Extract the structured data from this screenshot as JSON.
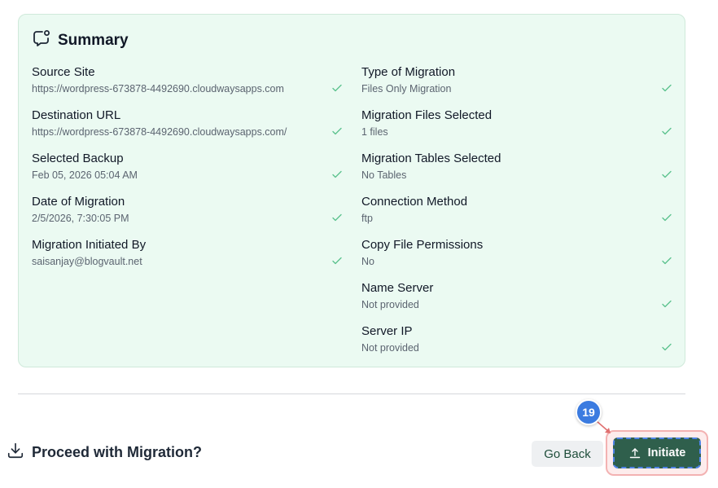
{
  "summary": {
    "title": "Summary",
    "left_fields": [
      {
        "label": "Source Site",
        "value": "https://wordpress-673878-4492690.cloudwaysapps.com"
      },
      {
        "label": "Destination URL",
        "value": "https://wordpress-673878-4492690.cloudwaysapps.com/"
      },
      {
        "label": "Selected Backup",
        "value": "Feb 05, 2026 05:04 AM"
      },
      {
        "label": "Date of Migration",
        "value": "2/5/2026, 7:30:05 PM"
      },
      {
        "label": "Migration Initiated By",
        "value": "saisanjay@blogvault.net"
      }
    ],
    "right_fields": [
      {
        "label": "Type of Migration",
        "value": "Files Only Migration"
      },
      {
        "label": "Migration Files Selected",
        "value": "1 files"
      },
      {
        "label": "Migration Tables Selected",
        "value": "No Tables"
      },
      {
        "label": "Connection Method",
        "value": "ftp"
      },
      {
        "label": "Copy File Permissions",
        "value": "No"
      },
      {
        "label": "Name Server",
        "value": "Not provided"
      },
      {
        "label": "Server IP",
        "value": "Not provided"
      }
    ]
  },
  "proceed": {
    "title": "Proceed with Migration?",
    "go_back_label": "Go Back",
    "initiate_label": "Initiate"
  },
  "step_badge": "19",
  "colors": {
    "card_bg": "#ebfaf2",
    "check": "#5cc28f",
    "primary_button": "#2f5f4c",
    "badge": "#3b7be0",
    "highlight": "#f3b2b2"
  }
}
